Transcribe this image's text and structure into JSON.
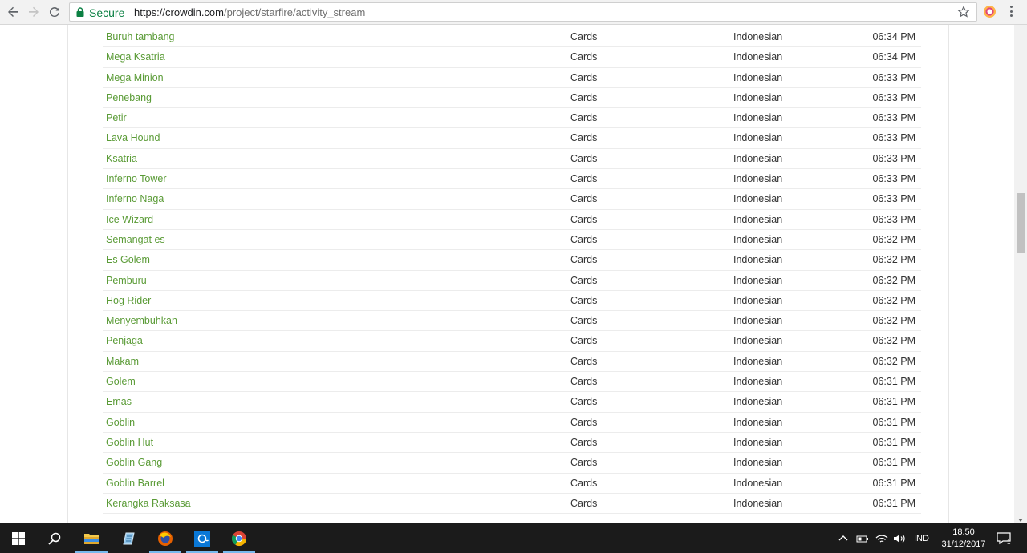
{
  "browser": {
    "secure_label": "Secure",
    "url_host": "https://crowdin.com",
    "url_path": "/project/starfire/activity_stream"
  },
  "activity": [
    {
      "name": "Buruh tambang",
      "type": "Cards",
      "language": "Indonesian",
      "time": "06:34 PM"
    },
    {
      "name": "Mega Ksatria",
      "type": "Cards",
      "language": "Indonesian",
      "time": "06:34 PM"
    },
    {
      "name": "Mega Minion",
      "type": "Cards",
      "language": "Indonesian",
      "time": "06:33 PM"
    },
    {
      "name": "Penebang",
      "type": "Cards",
      "language": "Indonesian",
      "time": "06:33 PM"
    },
    {
      "name": "Petir",
      "type": "Cards",
      "language": "Indonesian",
      "time": "06:33 PM"
    },
    {
      "name": "Lava Hound",
      "type": "Cards",
      "language": "Indonesian",
      "time": "06:33 PM"
    },
    {
      "name": "Ksatria",
      "type": "Cards",
      "language": "Indonesian",
      "time": "06:33 PM"
    },
    {
      "name": "Inferno Tower",
      "type": "Cards",
      "language": "Indonesian",
      "time": "06:33 PM"
    },
    {
      "name": "Inferno Naga",
      "type": "Cards",
      "language": "Indonesian",
      "time": "06:33 PM"
    },
    {
      "name": "Ice Wizard",
      "type": "Cards",
      "language": "Indonesian",
      "time": "06:33 PM"
    },
    {
      "name": "Semangat es",
      "type": "Cards",
      "language": "Indonesian",
      "time": "06:32 PM"
    },
    {
      "name": "Es Golem",
      "type": "Cards",
      "language": "Indonesian",
      "time": "06:32 PM"
    },
    {
      "name": "Pemburu",
      "type": "Cards",
      "language": "Indonesian",
      "time": "06:32 PM"
    },
    {
      "name": "Hog Rider",
      "type": "Cards",
      "language": "Indonesian",
      "time": "06:32 PM"
    },
    {
      "name": "Menyembuhkan",
      "type": "Cards",
      "language": "Indonesian",
      "time": "06:32 PM"
    },
    {
      "name": "Penjaga",
      "type": "Cards",
      "language": "Indonesian",
      "time": "06:32 PM"
    },
    {
      "name": "Makam",
      "type": "Cards",
      "language": "Indonesian",
      "time": "06:32 PM"
    },
    {
      "name": "Golem",
      "type": "Cards",
      "language": "Indonesian",
      "time": "06:31 PM"
    },
    {
      "name": "Emas",
      "type": "Cards",
      "language": "Indonesian",
      "time": "06:31 PM"
    },
    {
      "name": "Goblin",
      "type": "Cards",
      "language": "Indonesian",
      "time": "06:31 PM"
    },
    {
      "name": "Goblin Hut",
      "type": "Cards",
      "language": "Indonesian",
      "time": "06:31 PM"
    },
    {
      "name": "Goblin Gang",
      "type": "Cards",
      "language": "Indonesian",
      "time": "06:31 PM"
    },
    {
      "name": "Goblin Barrel",
      "type": "Cards",
      "language": "Indonesian",
      "time": "06:31 PM"
    },
    {
      "name": "Kerangka Raksasa",
      "type": "Cards",
      "language": "Indonesian",
      "time": "06:31 PM"
    }
  ],
  "colors": {
    "link_green": "#5a9b36",
    "secure_green": "#0b8043",
    "taskbar": "#1b1b1b"
  },
  "taskbar": {
    "language": "IND",
    "time": "18.50",
    "date": "31/12/2017",
    "notification_count": "1"
  }
}
